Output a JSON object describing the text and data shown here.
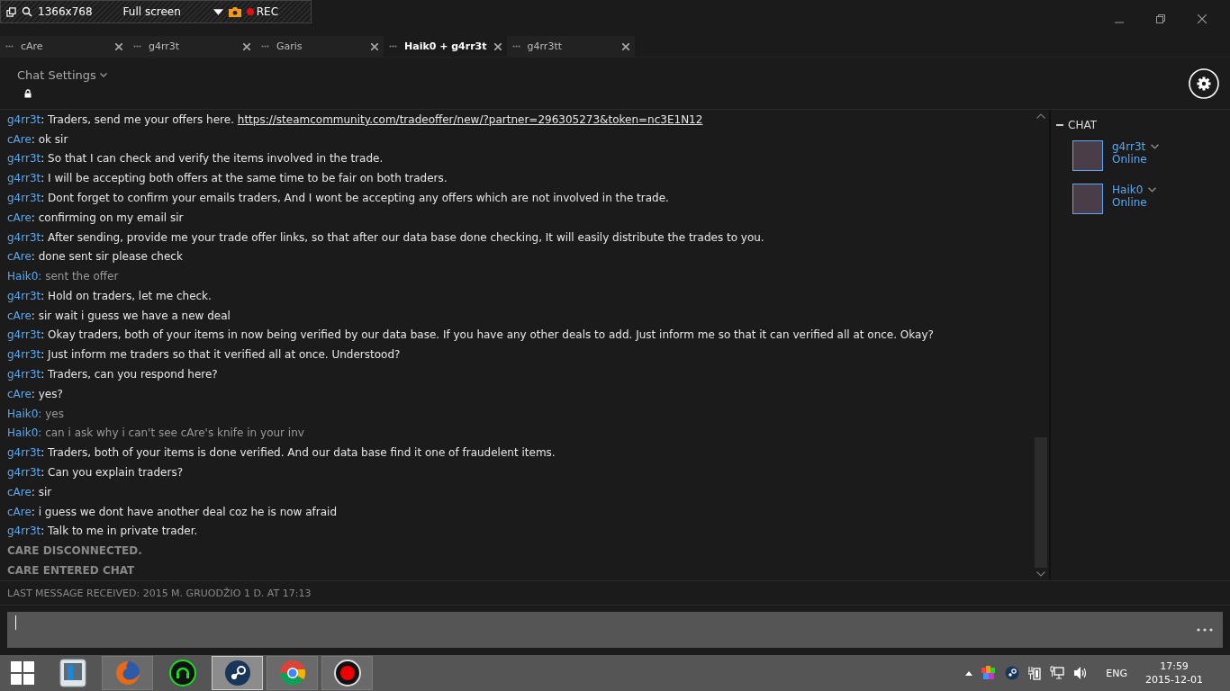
{
  "recorder_bar": {
    "resolution": "1366x768",
    "mode": "Full screen",
    "rec": "REC"
  },
  "tabs": [
    {
      "label": "cAre",
      "selected": false
    },
    {
      "label": "g4rr3t",
      "selected": false
    },
    {
      "label": "Garis",
      "selected": false
    },
    {
      "label": "Haik0 + g4rr3t",
      "selected": true
    },
    {
      "label": "g4rr3tt",
      "selected": false
    }
  ],
  "chat_settings": {
    "label": "Chat Settings"
  },
  "messages": [
    {
      "kind": "other",
      "name": "g4rr3t",
      "text": ": Traders, send me your offers here. ",
      "link": "https://steamcommunity.com/tradeoffer/new/?partner=296305273&token=nc3E1N12"
    },
    {
      "kind": "other",
      "name": "cAre",
      "text": ": ok sir"
    },
    {
      "kind": "other",
      "name": "g4rr3t",
      "text": ": So that I can check and verify the items involved in the trade."
    },
    {
      "kind": "other",
      "name": "g4rr3t",
      "text": ": I will be accepting both offers at the same time to be fair on both traders."
    },
    {
      "kind": "other",
      "name": "g4rr3t",
      "text": ": Dont forget to confirm your emails traders, And I wont be accepting any offers which are not involved in the trade."
    },
    {
      "kind": "other",
      "name": "cAre",
      "text": ": confirming on my email sir"
    },
    {
      "kind": "other",
      "name": "g4rr3t",
      "text": ": After sending, provide me your trade offer links, so that after our data base done checking, It will easily distribute the trades to you."
    },
    {
      "kind": "other",
      "name": "cAre",
      "text": ": done sent sir please check"
    },
    {
      "kind": "self",
      "name": "Haik0",
      "text": ": sent the offer"
    },
    {
      "kind": "other",
      "name": "g4rr3t",
      "text": ": Hold on traders, let me check."
    },
    {
      "kind": "other",
      "name": "cAre",
      "text": ": sir wait i guess we have a new deal"
    },
    {
      "kind": "other",
      "name": "g4rr3t",
      "text": ": Okay traders, both of your items in now being verified by our data base. If you have any other deals to add. Just inform me so that it can verified all at once. Okay?"
    },
    {
      "kind": "other",
      "name": "g4rr3t",
      "text": ": Just inform me traders so that it verified all at once. Understood?"
    },
    {
      "kind": "other",
      "name": "g4rr3t",
      "text": ": Traders, can you respond here?"
    },
    {
      "kind": "other",
      "name": "cAre",
      "text": ": yes?"
    },
    {
      "kind": "self",
      "name": "Haik0",
      "text": ": yes"
    },
    {
      "kind": "self",
      "name": "Haik0",
      "text": ": can i ask why i can't see cAre's knife in your inv"
    },
    {
      "kind": "other",
      "name": "g4rr3t",
      "text": ": Traders, both of your items is done verified. And our data base find it one of fraudelent items."
    },
    {
      "kind": "other",
      "name": "g4rr3t",
      "text": ": Can you explain traders?"
    },
    {
      "kind": "other",
      "name": "cAre",
      "text": ": sir"
    },
    {
      "kind": "other",
      "name": "cAre",
      "text": ": i guess we dont  have another deal coz he is now afraid"
    },
    {
      "kind": "other",
      "name": "g4rr3t",
      "text": ": Talk to me in private trader."
    },
    {
      "kind": "system",
      "text": "CARE DISCONNECTED."
    },
    {
      "kind": "system",
      "text": "CARE ENTERED CHAT"
    }
  ],
  "status_line": "LAST MESSAGE RECEIVED: 2015 M. GRUODŽIO 1 D. AT 17:13",
  "members": {
    "heading": "CHAT",
    "items": [
      {
        "name": "g4rr3t",
        "status": "Online"
      },
      {
        "name": "Haik0",
        "status": "Online"
      }
    ]
  },
  "taskbar": {
    "apps": [
      {
        "kind": "files",
        "running": false,
        "active": false
      },
      {
        "kind": "firefox",
        "running": true,
        "active": false
      },
      {
        "kind": "headset",
        "running": false,
        "active": false
      },
      {
        "kind": "steam",
        "running": true,
        "active": true
      },
      {
        "kind": "chrome",
        "running": true,
        "active": false
      },
      {
        "kind": "record",
        "running": true,
        "active": false
      }
    ],
    "language": "ENG",
    "time": "17:59",
    "date": "2015-12-01"
  }
}
